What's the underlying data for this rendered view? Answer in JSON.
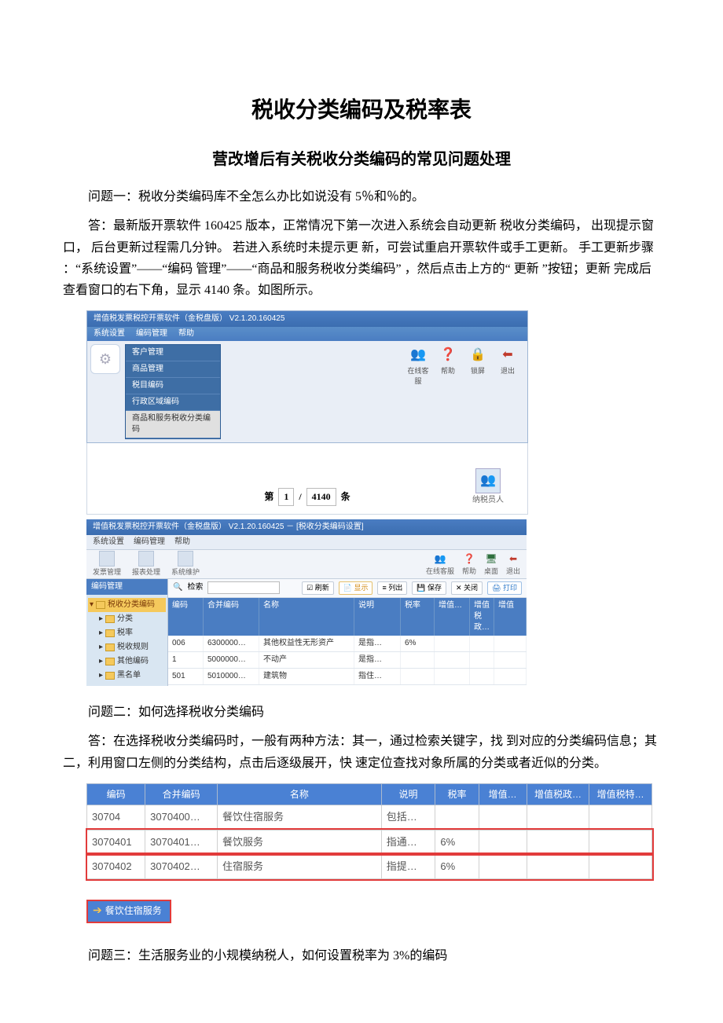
{
  "title": "税收分类编码及税率表",
  "subtitle": "营改增后有关税收分类编码的常见问题处理",
  "paragraphs": {
    "q1": "问题一：税收分类编码库不全怎么办比如说没有 5％和％的。",
    "a1": "答：最新版开票软件 160425 版本，正常情况下第一次进入系统会自动更新 税收分类编码， 出现提示窗口， 后台更新过程需几分钟。 若进入系统时未提示更 新，可尝试重启开票软件或手工更新。 手工更新步骤 ：“系统设置”——“编码 管理”——“商品和服务税收分类编码” ，然后点击上方的“ 更新 ”按钮；更新 完成后查看窗口的右下角，显示 4140 条。如图所示。",
    "q2": "问题二：如何选择税收分类编码",
    "a2": "答：在选择税收分类编码时，一般有两种方法：其一，通过检索关键字，找 到对应的分类编码信息；其二，利用窗口左侧的分类结构，点击后逐级展开，快 速定位查找对象所属的分类或者近似的分类。",
    "q3": "问题三：生活服务业的小规模纳税人，如何设置税率为 3%的编码"
  },
  "screenshot1": {
    "titlebar": "增值税发票税控开票软件（金税盘版） V2.1.20.160425",
    "menubar": [
      "系统设置",
      "编码管理",
      "帮助"
    ],
    "menu_list": [
      "客户管理",
      "商品管理",
      "税目编码",
      "行政区域编码",
      "商品和服务税收分类编码"
    ],
    "tools": [
      {
        "icon": "👥",
        "label": "在线客服"
      },
      {
        "icon": "❓",
        "label": "帮助"
      },
      {
        "icon": "🔒",
        "label": "锁屏"
      },
      {
        "icon": "⬅",
        "label": "退出"
      }
    ],
    "pager": {
      "label_left": "第",
      "page": "1",
      "sep": "/",
      "total": "4140",
      "label_right": "条"
    },
    "avatar2_label": "纳税员人"
  },
  "screenshot2": {
    "titlebar": "增值税发票税控开票软件（金税盘版） V2.1.20.160425 － [税收分类编码设置]",
    "menubar": [
      "系统设置",
      "编码管理",
      "帮助"
    ],
    "toolbar_left": [
      "发票管理",
      "报表处理",
      "系统维护"
    ],
    "toolbar_right": [
      {
        "icon": "👥",
        "label": "在线客服"
      },
      {
        "icon": "❓",
        "label": "帮助"
      },
      {
        "icon": "🖥",
        "label": "桌面"
      },
      {
        "icon": "⬅",
        "label": "退出"
      }
    ],
    "side_header": "编码管理",
    "tree": [
      "税收分类编码",
      "分类",
      "税率",
      "税收规则",
      "其他编码",
      "黑名单"
    ],
    "search_label": "检索",
    "action_buttons": [
      "刷新",
      "显示",
      "列出",
      "保存",
      "关闭",
      "打印"
    ],
    "columns": [
      "编码",
      "合并编码",
      "名称",
      "说明",
      "税率",
      "增值…",
      "增值税政…",
      "增值"
    ],
    "rows": [
      {
        "c1": "006",
        "c2": "6300000…",
        "c3": "其他权益性无形资产",
        "c4": "是指…",
        "c5": "6%",
        "c6": "",
        "c7": "",
        "c8": ""
      },
      {
        "c1": "1",
        "c2": "5000000…",
        "c3": "不动产",
        "c4": "是指…",
        "c5": "",
        "c6": "",
        "c7": "",
        "c8": ""
      },
      {
        "c1": "501",
        "c2": "5010000…",
        "c3": "建筑物",
        "c4": "指住…",
        "c5": "",
        "c6": "",
        "c7": "",
        "c8": ""
      }
    ]
  },
  "table2": {
    "headers": [
      "编码",
      "合并编码",
      "名称",
      "说明",
      "税率",
      "增值…",
      "增值税政…",
      "增值税特…"
    ],
    "rows": [
      {
        "code": "30704",
        "merge": "3070400…",
        "name": "餐饮住宿服务",
        "desc": "包括…",
        "rate": "",
        "v1": "",
        "v2": "",
        "v3": ""
      },
      {
        "code": "3070401",
        "merge": "3070401…",
        "name": "餐饮服务",
        "desc": "指通…",
        "rate": "6%",
        "v1": "",
        "v2": "",
        "v3": ""
      },
      {
        "code": "3070402",
        "merge": "3070402…",
        "name": "住宿服务",
        "desc": "指提…",
        "rate": "6%",
        "v1": "",
        "v2": "",
        "v3": ""
      }
    ]
  },
  "breadcrumb_tag": "餐饮住宿服务"
}
